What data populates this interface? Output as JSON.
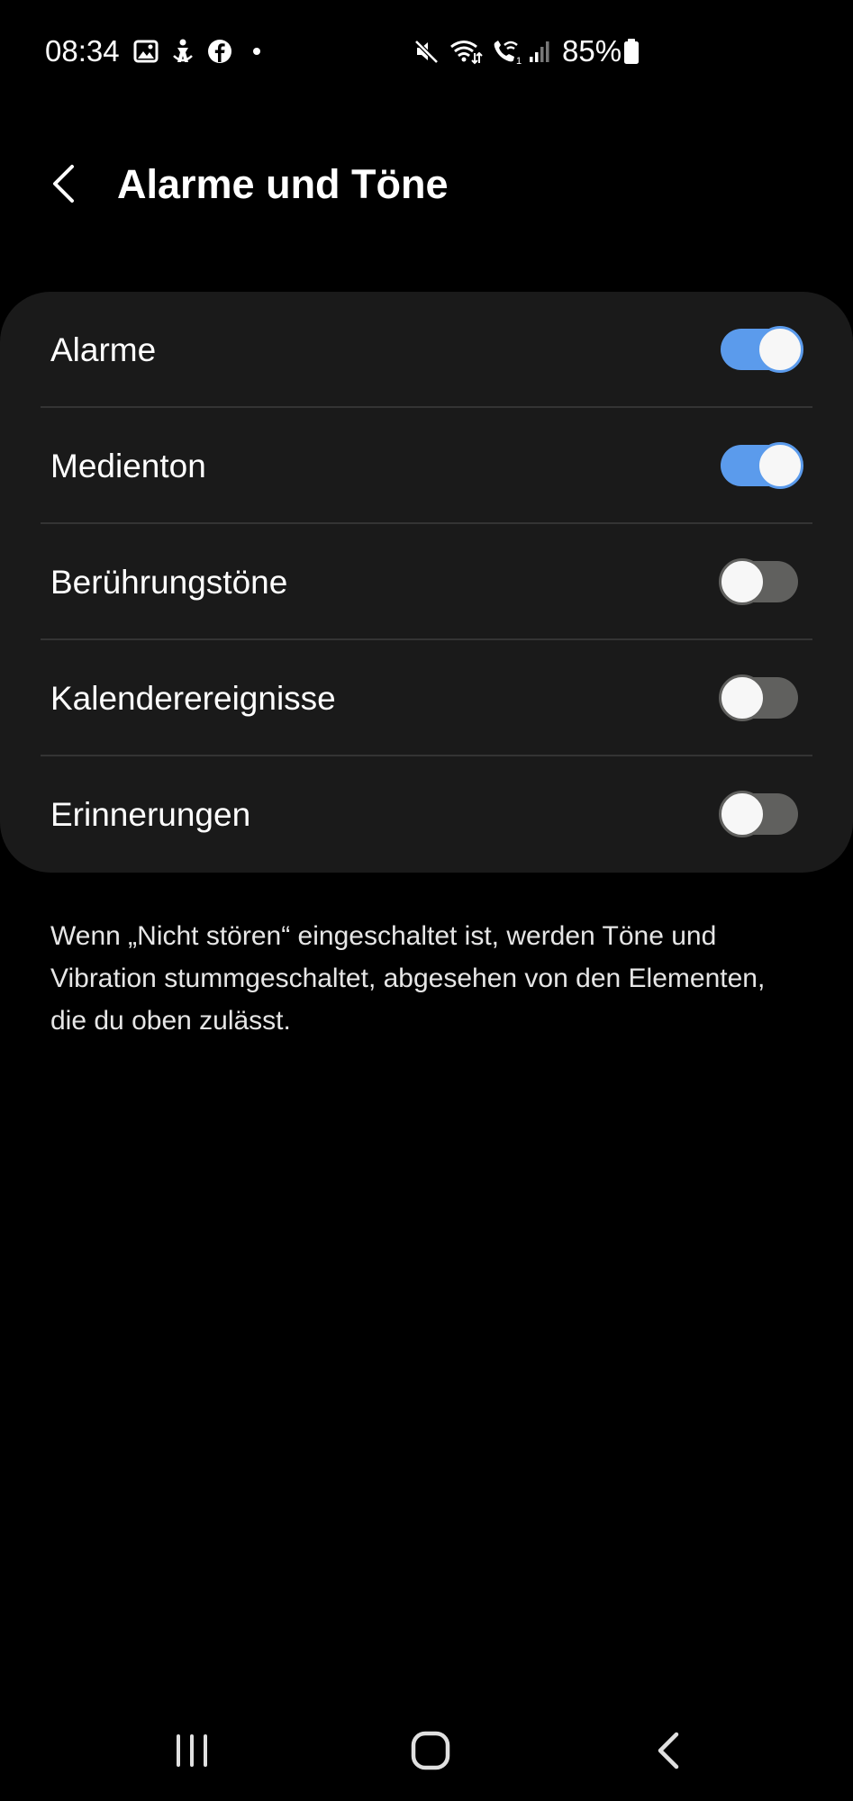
{
  "status_bar": {
    "time": "08:34",
    "battery": "85%",
    "left_icons": [
      "gallery-icon",
      "accessibility-icon",
      "facebook-icon",
      "notification-dot-icon"
    ],
    "right_icons": [
      "mute-icon",
      "wifi-icon",
      "wifi-call-icon",
      "signal-icon",
      "battery-icon"
    ]
  },
  "header": {
    "title": "Alarme und Töne"
  },
  "settings": {
    "items": [
      {
        "label": "Alarme",
        "enabled": true
      },
      {
        "label": "Medienton",
        "enabled": true
      },
      {
        "label": "Berührungstöne",
        "enabled": false
      },
      {
        "label": "Kalenderereignisse",
        "enabled": false
      },
      {
        "label": "Erinnerungen",
        "enabled": false
      }
    ]
  },
  "description": "Wenn „Nicht stören“ eingeschaltet ist, werden Töne und Vibration stummgeschaltet, abgesehen von den Elementen, die du oben zulässt.",
  "nav_bar": {
    "buttons": [
      "recent-apps-icon",
      "home-icon",
      "back-icon"
    ]
  },
  "colors": {
    "background": "#000000",
    "card": "#1a1a1a",
    "toggle_on": "#5b9bec",
    "toggle_off": "#60605e",
    "text": "#ffffff"
  }
}
